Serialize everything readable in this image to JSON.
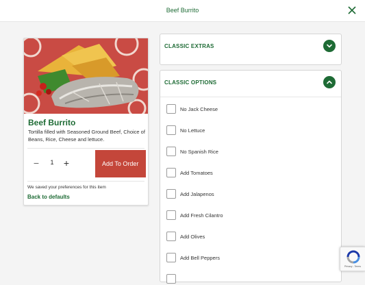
{
  "header": {
    "title": "Beef Burrito",
    "close_icon": "close-icon"
  },
  "product": {
    "name": "Beef Burrito",
    "description": "Tortilla filled with Seasoned Ground Beef, Choice of Beans, Rice, Cheese and lettuce.",
    "quantity": "1",
    "minus_symbol": "−",
    "plus_symbol": "+",
    "add_button": "Add To Order",
    "saved_note": "We saved your preferences for this item",
    "back_link": "Back to defaults"
  },
  "panels": {
    "extras": {
      "title": "CLASSIC EXTRAS",
      "state": "collapsed"
    },
    "options": {
      "title": "CLASSIC OPTIONS",
      "state": "expanded",
      "items": [
        {
          "label": "No Jack Cheese",
          "checked": false
        },
        {
          "label": "No Lettuce",
          "checked": false
        },
        {
          "label": "No Spanish Rice",
          "checked": false
        },
        {
          "label": "Add Tomatoes",
          "checked": false
        },
        {
          "label": "Add Jalapenos",
          "checked": false
        },
        {
          "label": "Add Fresh Cilantro",
          "checked": false
        },
        {
          "label": "Add Olives",
          "checked": false
        },
        {
          "label": "Add Bell Peppers",
          "checked": false
        }
      ]
    }
  },
  "recaptcha": {
    "footer": "Privacy - Terms"
  },
  "colors": {
    "brand_green": "#1e6b35",
    "add_button_red": "#c4463a"
  }
}
